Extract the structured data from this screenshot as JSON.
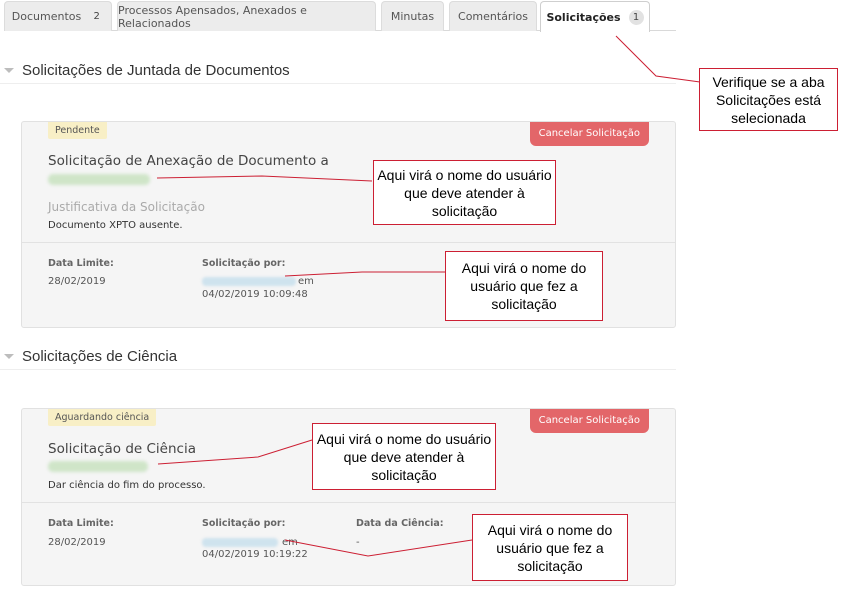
{
  "tabs": [
    {
      "label": "Documentos",
      "count": "2"
    },
    {
      "label": "Processos Apensados, Anexados e Relacionados",
      "count": ""
    },
    {
      "label": "Minutas",
      "count": ""
    },
    {
      "label": "Comentários",
      "count": ""
    },
    {
      "label": "Solicitações",
      "count": "1",
      "active": true
    }
  ],
  "juntada": {
    "section_title": "Solicitações de Juntada de Documentos",
    "status": "Pendente",
    "cancel_label": "Cancelar Solicitação",
    "title": "Solicitação de Anexação de Documento a",
    "justification_label": "Justificativa da Solicitação",
    "justification_text": "Documento XPTO ausente.",
    "deadline_label": "Data Limite:",
    "deadline": "28/02/2019",
    "requested_by_label": "Solicitação por:",
    "em": "em",
    "requested_at": "04/02/2019 10:09:48"
  },
  "ciencia": {
    "section_title": "Solicitações de Ciência",
    "status": "Aguardando ciência",
    "cancel_label": "Cancelar Solicitação",
    "title": "Solicitação de Ciência",
    "description": "Dar ciência do fim do processo.",
    "deadline_label": "Data Limite:",
    "deadline": "28/02/2019",
    "requested_by_label": "Solicitação por:",
    "em": "em",
    "requested_at": "04/02/2019 10:19:22",
    "science_date_label": "Data da Ciência:",
    "science_date": "-"
  },
  "annotations": {
    "tab_note": "Verifique se a aba Solicitações está selecionada",
    "assignee_note_1": "Aqui virá o nome do usuário que deve atender à solicitação",
    "requester_note_1": "Aqui virá o nome do usuário que fez a solicitação",
    "assignee_note_2": "Aqui virá o nome do usuário que deve atender à solicitação",
    "requester_note_2": "Aqui virá o nome do usuário que fez a solicitação",
    "border_color": "#cc1f33"
  },
  "colors": {
    "cancel_button": "#e36669",
    "status_badge": "#f8efc6",
    "card_background": "#f5f5f5"
  }
}
